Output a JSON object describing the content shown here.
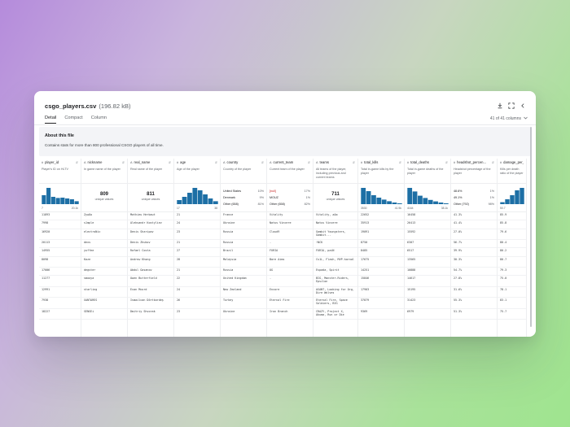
{
  "file": {
    "name": "csgo_players.csv",
    "size": "(196.82 kB)"
  },
  "title_icons": [
    "download-icon",
    "expand-icon",
    "collapse-icon"
  ],
  "tabs": [
    {
      "label": "Detail",
      "active": true
    },
    {
      "label": "Compact",
      "active": false
    },
    {
      "label": "Column",
      "active": false
    }
  ],
  "column_count": "41 of 41 columns",
  "about": {
    "title": "About this file",
    "description": "Contains stats for more than 800 professional CSGO players of all time."
  },
  "accent_color": "#1d6fa5",
  "columns": [
    {
      "key": "player_id",
      "type": "#",
      "name": "player_id",
      "desc": "Player's ID on HLTV",
      "stat": {
        "kind": "hist",
        "lo": "7",
        "hi": "20.1k",
        "bars": [
          0.55,
          1.0,
          0.45,
          0.38,
          0.4,
          0.35,
          0.3,
          0.18
        ]
      },
      "rows": [
        "11893",
        "7998",
        "16920",
        "20113",
        "14955",
        "8098",
        "17006",
        "11277",
        "12991",
        "7938",
        "18227"
      ]
    },
    {
      "key": "nickname",
      "type": "A",
      "name": "nickname",
      "desc": "In game name of the player",
      "stat": {
        "kind": "unique",
        "value": "809",
        "label": "unique values"
      },
      "rows": [
        "ZywOo",
        "s1mple",
        "electroNic",
        "dexs",
        "yuffee",
        "Kaze",
        "degster",
        "smooya",
        "starling",
        "XANTARES",
        "SENSEi"
      ]
    },
    {
      "key": "real_name",
      "type": "A",
      "name": "real_name",
      "desc": "Real name of the player",
      "stat": {
        "kind": "unique",
        "value": "811",
        "label": "unique values"
      },
      "rows": [
        "Mathieu Herbaut",
        "Aleksandr Kostyliev",
        "Denis Sharipov",
        "Denis Zhukov",
        "Rafael Costa",
        "Andrew Khong",
        "Abdul Gasanov",
        "Owen Butterfield",
        "Evan Mcord",
        "Ismailcan Dörtkardeş",
        "Dmitriy Shvorak"
      ]
    },
    {
      "key": "age",
      "type": "#",
      "name": "age",
      "desc": "Age of the player",
      "stat": {
        "kind": "hist",
        "lo": "17",
        "hi": "38",
        "bars": [
          0.25,
          0.45,
          0.7,
          1.0,
          0.85,
          0.6,
          0.35,
          0.18
        ]
      },
      "rows": [
        "21",
        "24",
        "23",
        "21",
        "27",
        "28",
        "21",
        "22",
        "24",
        "26",
        "23"
      ]
    },
    {
      "key": "country",
      "type": "A",
      "name": "country",
      "desc": "Country of the player",
      "stat": {
        "kind": "cat",
        "rows": [
          {
            "name": "United States",
            "value": "10%"
          },
          {
            "name": "Denmark",
            "value": "9%"
          },
          {
            "name": "Other (658)",
            "value": "81%"
          }
        ]
      },
      "rows": [
        "France",
        "Ukraine",
        "Russia",
        "Russia",
        "Brazil",
        "Malaysia",
        "Russia",
        "United Kingdom",
        "New Zealand",
        "Turkey",
        "Ukraine"
      ]
    },
    {
      "key": "current_team",
      "type": "A",
      "name": "current_team",
      "desc": "Current team of the player",
      "stat": {
        "kind": "cat",
        "rows": [
          {
            "name": "[null]",
            "value": "17%",
            "red": true
          },
          {
            "name": "MOUZ",
            "value": "1%"
          },
          {
            "name": "Other (658)",
            "value": "82%"
          }
        ]
      },
      "rows": [
        "Vitality",
        "Natus Vincere",
        "Cloud9",
        "-",
        "FURIA",
        "Bare Aims",
        "OG",
        "-",
        "Encore",
        "Eternal Fire",
        "Iron Branch"
      ]
    },
    {
      "key": "teams",
      "type": "A",
      "name": "teams",
      "desc": "All teams of the player, including previous and current teams",
      "stat": {
        "kind": "unique",
        "value": "711",
        "label": "unique values"
      },
      "rows": [
        "Vitality, aAa",
        "Natus Vincere",
        "Gambit Youngsters, Gambit...",
        "!NCK",
        "FURIA, paiN",
        "Cs1L, Flash, MVP.karnal",
        "Espada, Spirit",
        "BIG, Monster-Riders, Epsilon",
        "ASANT, Looking for Org, Dire Wolves",
        "Eternal Fire, Space Soldiers, BIG",
        "CRAZY, Project X, Akuma, Run or Die"
      ]
    },
    {
      "key": "total_kills",
      "type": "#",
      "name": "total_kills",
      "desc": "Total in-game kills by the player",
      "stat": {
        "kind": "hist",
        "lo": "3530",
        "hi": "41.9k",
        "bars": [
          1.0,
          0.8,
          0.55,
          0.4,
          0.28,
          0.18,
          0.1,
          0.05
        ]
      },
      "rows": [
        "22652",
        "35913",
        "19091",
        "8750",
        "8485",
        "17675",
        "14251",
        "15846",
        "17903",
        "37879",
        "9369"
      ]
    },
    {
      "key": "total_deaths",
      "type": "#",
      "name": "total_deaths",
      "desc": "Total in-game deaths of the player",
      "stat": {
        "kind": "hist",
        "lo": "4164",
        "hi": "38.1k",
        "bars": [
          1.0,
          0.78,
          0.52,
          0.38,
          0.26,
          0.17,
          0.1,
          0.05
        ]
      },
      "rows": [
        "16458",
        "26413",
        "15592",
        "6307",
        "6517",
        "13565",
        "10888",
        "14617",
        "15195",
        "31423",
        "6979"
      ]
    },
    {
      "key": "headshot_percentage",
      "type": "#",
      "name": "headshot_percen...",
      "desc": "Headshot percentage of the player",
      "stat": {
        "kind": "cat",
        "rows": [
          {
            "name": "48.6%",
            "value": "1%"
          },
          {
            "name": "49.1%",
            "value": "1%"
          },
          {
            "name": "Other (792)",
            "value": "98%"
          }
        ]
      },
      "rows": [
        "41.3%",
        "41.4%",
        "27.0%",
        "56.7%",
        "39.9%",
        "30.3%",
        "54.7%",
        "27.8%",
        "31.6%",
        "55.3%",
        "51.3%"
      ]
    },
    {
      "key": "damage_per_round",
      "type": "#",
      "name": "damage_per_roun...",
      "desc": "Kills per death ratio of the player",
      "stat": {
        "kind": "hist",
        "lo": "50.7",
        "hi": "",
        "bars": [
          0.12,
          0.3,
          0.55,
          0.85,
          1.0
        ]
      },
      "rows": [
        "85.9",
        "85.8",
        "79.6",
        "80.4",
        "80.2",
        "80.7",
        "79.3",
        "75.0",
        "78.1",
        "83.1",
        "75.7"
      ]
    }
  ]
}
